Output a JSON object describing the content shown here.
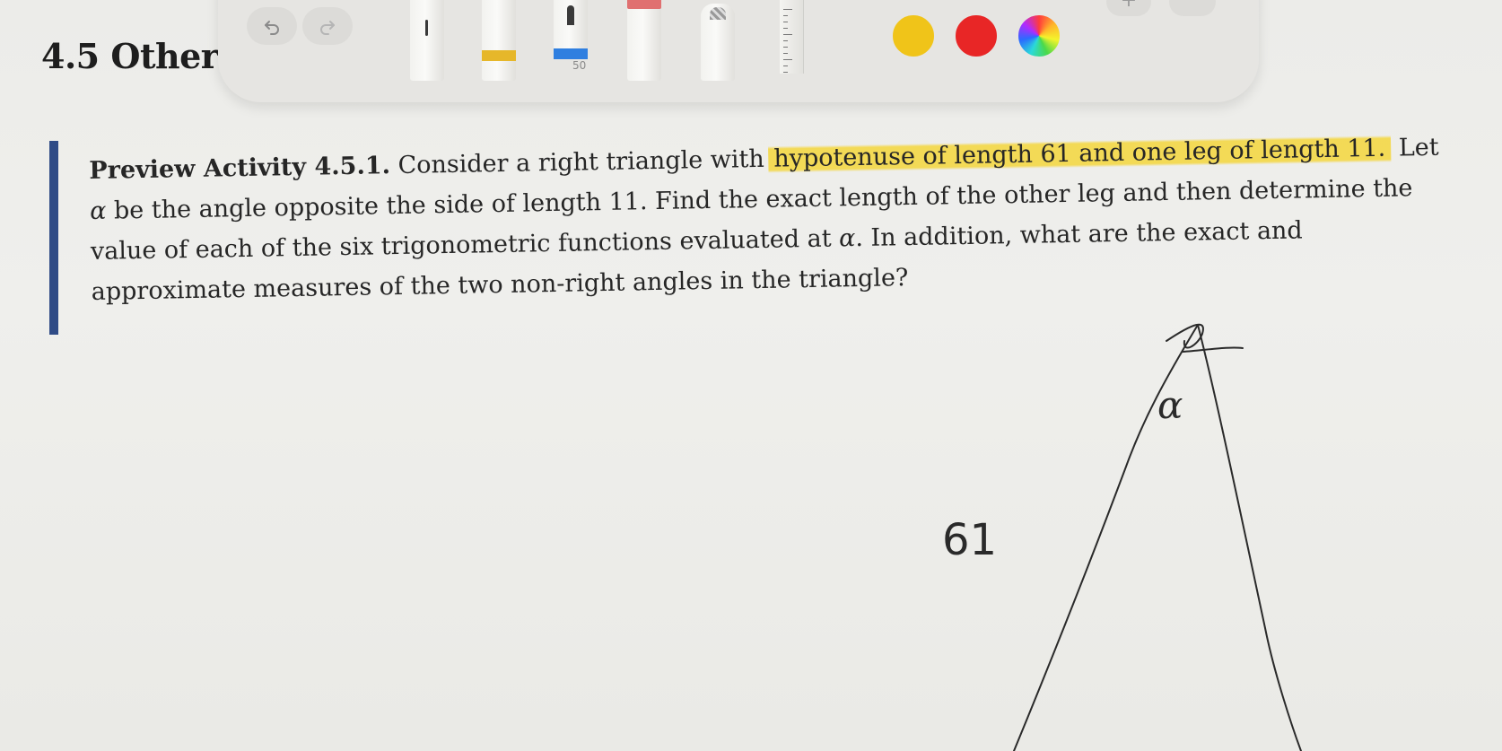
{
  "section": {
    "heading": "4.5 Other"
  },
  "toolbar": {
    "undo_icon": "undo-icon",
    "redo_icon": "redo-icon",
    "tools": [
      {
        "name": "monoline-pen",
        "tip_color": "#3a3a3a"
      },
      {
        "name": "highlighter",
        "band_color": "#e6b72a"
      },
      {
        "name": "pencil",
        "band_color": "#2f7fe0",
        "size": "50"
      },
      {
        "name": "marker",
        "tip_color": "#e07070"
      },
      {
        "name": "eraser"
      },
      {
        "name": "ruler"
      }
    ],
    "size_label": "50",
    "colors": [
      "#f0c419",
      "#e82626",
      "multicolor-wheel"
    ],
    "plus_label": "+"
  },
  "activity": {
    "label": "Preview Activity 4.5.1.",
    "text_before_highlight": "Consider a right triangle with",
    "highlight_text": "hypotenuse of length 61 and one leg of length 11.",
    "let_word": "Let",
    "alpha": "α",
    "text_after_alpha": "be the angle opposite the side of length 11. Find the exact length of the other leg and then determine the value of each of the six trigonometric functions evaluated at",
    "alpha2": "α",
    "text_end": ". In addition, what are the exact and approximate measures of the two non-right angles in the triangle?",
    "bar_color": "#2f4b86",
    "highlight_color": "#f4d63c"
  },
  "handwriting": {
    "hypotenuse_label": "61",
    "angle_label": "α"
  }
}
